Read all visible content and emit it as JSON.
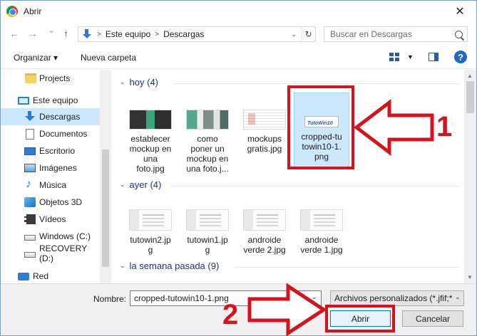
{
  "window": {
    "title": "Abrir",
    "close_glyph": "✕"
  },
  "nav": {
    "back_glyph": "←",
    "forward_glyph": "→",
    "recent_glyph": "⌄",
    "up_glyph": "↑",
    "breadcrumb": [
      "Este equipo",
      "Descargas"
    ],
    "search_placeholder": "Buscar en Descargas"
  },
  "toolbar": {
    "organize_label": "Organizar",
    "organize_glyph": "▾",
    "new_folder_label": "Nueva carpeta",
    "help_label": "?"
  },
  "sidebar": {
    "items": [
      {
        "label": "Projects",
        "icon": "folder-icon"
      },
      {
        "label": "Este equipo",
        "icon": "computer-icon"
      },
      {
        "label": "Descargas",
        "icon": "downloads-icon",
        "selected": true
      },
      {
        "label": "Documentos",
        "icon": "documents-icon"
      },
      {
        "label": "Escritorio",
        "icon": "desktop-icon"
      },
      {
        "label": "Imágenes",
        "icon": "pictures-icon"
      },
      {
        "label": "Música",
        "icon": "music-icon"
      },
      {
        "label": "Objetos 3D",
        "icon": "objects-3d-icon"
      },
      {
        "label": "Vídeos",
        "icon": "videos-icon"
      },
      {
        "label": "Windows (C:)",
        "icon": "drive-icon"
      },
      {
        "label": "RECOVERY (D:)",
        "icon": "drive-icon"
      },
      {
        "label": "Red",
        "icon": "network-icon"
      }
    ]
  },
  "groups": [
    {
      "header": "hoy (4)",
      "files": [
        {
          "name": "establecer mockup en una foto.jpg",
          "lines": [
            "establecer",
            "mockup en",
            "una",
            "foto.jpg"
          ]
        },
        {
          "name": "como poner un mockup en una foto.j...",
          "lines": [
            "como",
            "poner un",
            "mockup en",
            "una foto.j..."
          ]
        },
        {
          "name": "mockups gratis.jpg",
          "lines": [
            "mockups",
            "gratis.jpg"
          ]
        },
        {
          "name": "cropped-tutowin10-1.png",
          "lines": [
            "cropped-tu",
            "towin10-1.",
            "png"
          ],
          "selected": true,
          "thumb_text": "TutoWin10"
        }
      ]
    },
    {
      "header": "ayer (4)",
      "files": [
        {
          "name": "tutowin2.jpg",
          "lines": [
            "tutowin2.jp",
            "g"
          ]
        },
        {
          "name": "tutowin1.jpg",
          "lines": [
            "tutowin1.jp",
            "g"
          ]
        },
        {
          "name": "androide verde 2.jpg",
          "lines": [
            "androide",
            "verde 2.jpg"
          ]
        },
        {
          "name": "androide verde 1.jpg",
          "lines": [
            "androide",
            "verde 1.jpg"
          ]
        }
      ]
    },
    {
      "header": "la semana pasada (9)"
    }
  ],
  "footer": {
    "name_label": "Nombre:",
    "file_name_value": "cropped-tutowin10-1.png",
    "file_type_value": "Archivos personalizados (*.jfif;*",
    "dropdown_glyph": "⌄",
    "open_label": "Abrir",
    "cancel_label": "Cancelar"
  },
  "annotations": {
    "step1": "1",
    "step2": "2",
    "color": "#d3141f"
  }
}
